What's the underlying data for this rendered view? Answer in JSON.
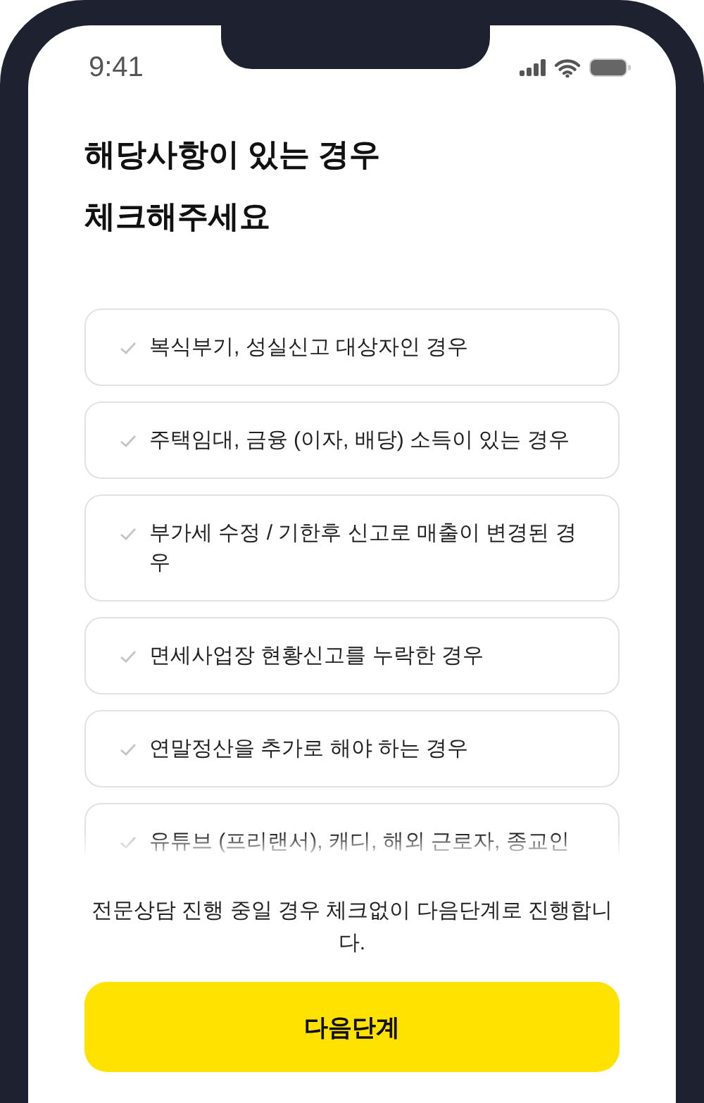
{
  "status_bar": {
    "time": "9:41"
  },
  "title": [
    "해당사항이 있는 경우",
    "체크해주세요"
  ],
  "items": [
    {
      "label": "복식부기, 성실신고 대상자인 경우",
      "checked": false
    },
    {
      "label": "주택임대, 금융 (이자, 배당) 소득이 있는 경우",
      "checked": false
    },
    {
      "label": "부가세 수정 / 기한후 신고로 매출이 변경된 경우",
      "checked": false
    },
    {
      "label": "면세사업장 현황신고를 누락한 경우",
      "checked": false
    },
    {
      "label": "연말정산을 추가로 해야 하는 경우",
      "checked": false
    },
    {
      "label": "유튜브 (프리랜서), 캐디, 해외 근로자, 종교인",
      "checked": false
    }
  ],
  "note": "전문상담 진행 중일 경우 체크없이 다음단계로 진행합니다.",
  "next_button": "다음단계"
}
